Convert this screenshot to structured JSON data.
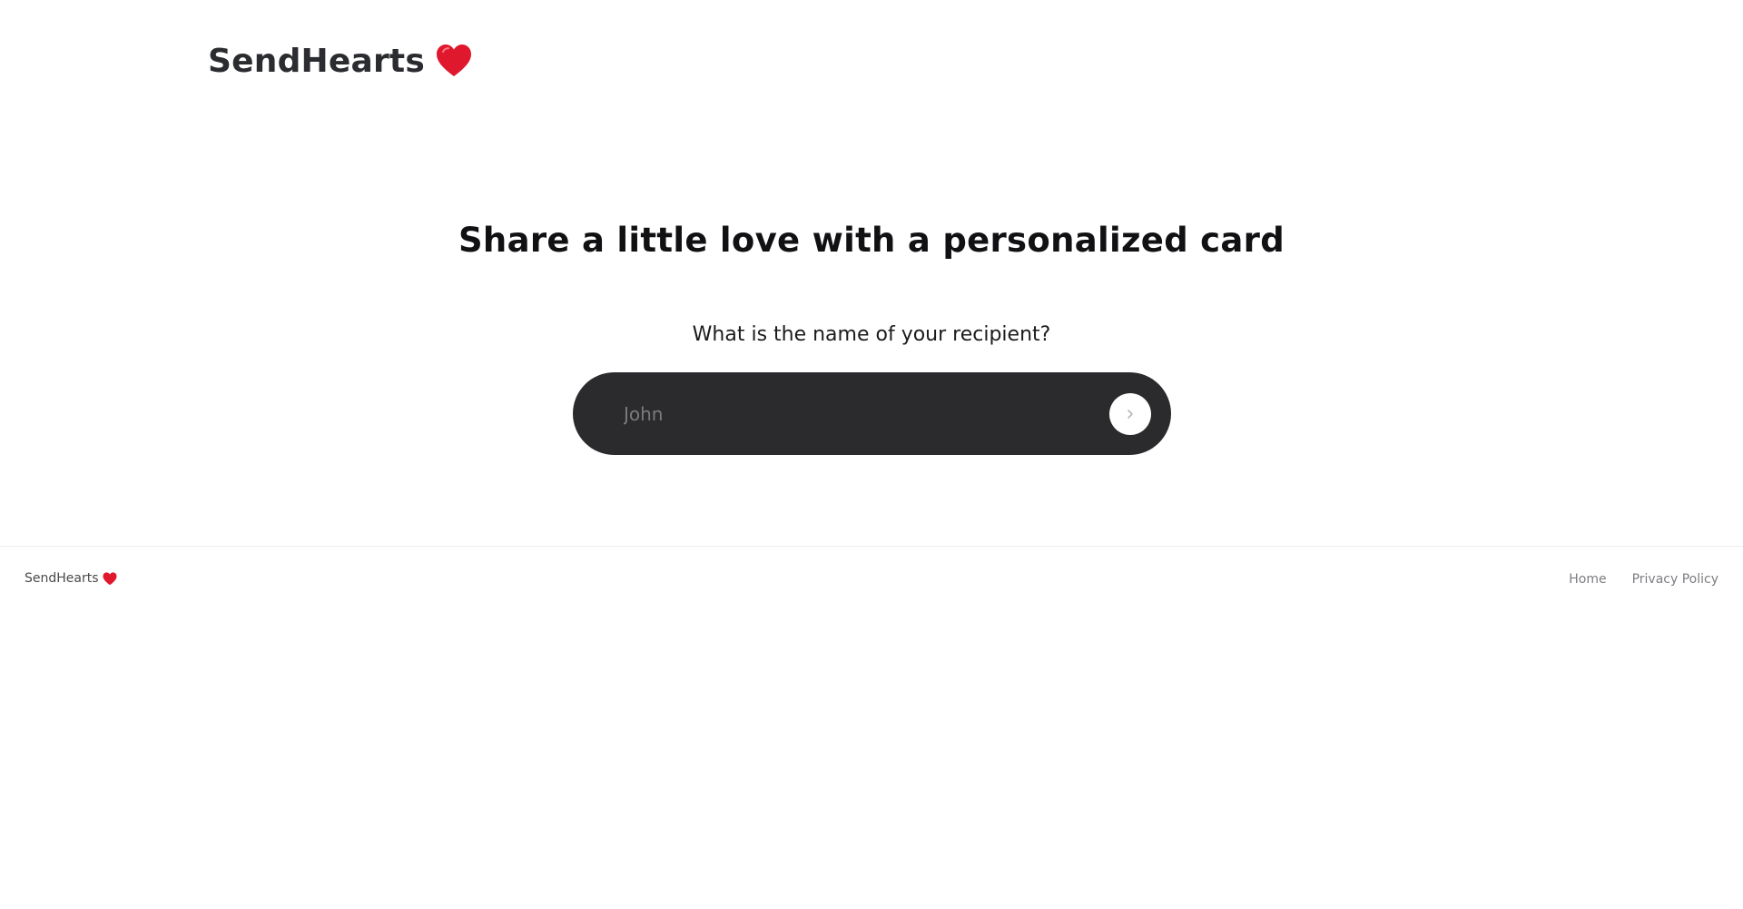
{
  "header": {
    "brand": "SendHearts",
    "brand_icon": "heart-icon",
    "brand_icon_color": "#e0182d"
  },
  "main": {
    "headline": "Share a little love with a personalized card",
    "question": "What is the name of your recipient?",
    "name_input": {
      "value": "",
      "placeholder": "John"
    },
    "next_icon": "chevron-right-icon"
  },
  "footer": {
    "brand": "SendHearts",
    "links": [
      {
        "label": "Home"
      },
      {
        "label": "Privacy Policy"
      }
    ]
  },
  "colors": {
    "pill_background": "#2b2b2d",
    "heart": "#e0182d",
    "text": "#111114"
  }
}
